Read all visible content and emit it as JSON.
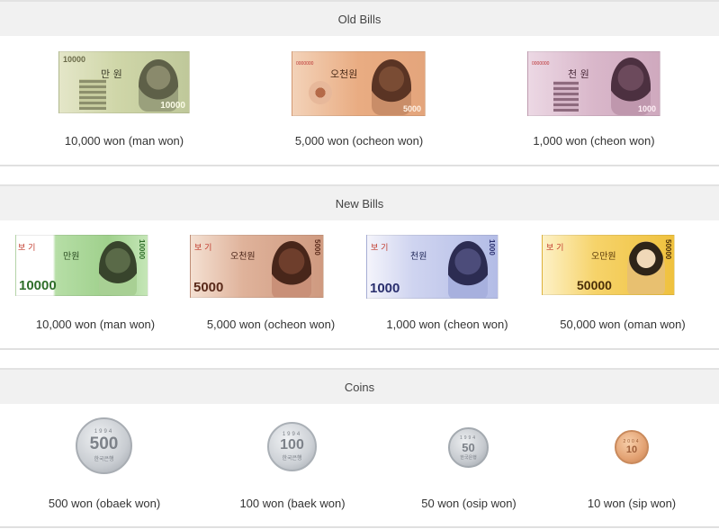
{
  "sections": {
    "old_bills": {
      "title": "Old Bills",
      "items": [
        {
          "caption": "10,000 won (man won)",
          "numeral": "10000",
          "kr_label": "만 원"
        },
        {
          "caption": "5,000 won (ocheon won)",
          "numeral": "5000",
          "kr_label": "오천원"
        },
        {
          "caption": "1,000 won (cheon won)",
          "numeral": "1000",
          "kr_label": "천 원"
        }
      ]
    },
    "new_bills": {
      "title": "New Bills",
      "items": [
        {
          "caption": "10,000 won (man won)",
          "numeral": "10000",
          "kr_label": "만원"
        },
        {
          "caption": "5,000 won (ocheon won)",
          "numeral": "5000",
          "kr_label": "오천원"
        },
        {
          "caption": "1,000 won (cheon won)",
          "numeral": "1000",
          "kr_label": "천원"
        },
        {
          "caption": "50,000 won (oman won)",
          "numeral": "50000",
          "kr_label": "오만원"
        }
      ]
    },
    "coins": {
      "title": "Coins",
      "items": [
        {
          "caption": "500 won (obaek won)",
          "numeral": "500",
          "year": "1994"
        },
        {
          "caption": "100 won (baek won)",
          "numeral": "100",
          "year": "1994"
        },
        {
          "caption": "50 won (osip won)",
          "numeral": "50",
          "year": "1994"
        },
        {
          "caption": "10 won (sip won)",
          "numeral": "10",
          "year": "2004"
        }
      ]
    }
  },
  "colors": {
    "header_bg": "#f1f1f1",
    "divider": "#e0e0e0",
    "old_10000": "#d9ddb8",
    "old_5000": "#e8b08c",
    "old_1000": "#d8b4c8",
    "new_10000": "#a9d69a",
    "new_5000": "#d8a890",
    "new_1000": "#b8c0e8",
    "new_50000": "#f2c84a",
    "coin_silver": "#cfd3d8",
    "coin_copper": "#e6a87a"
  }
}
